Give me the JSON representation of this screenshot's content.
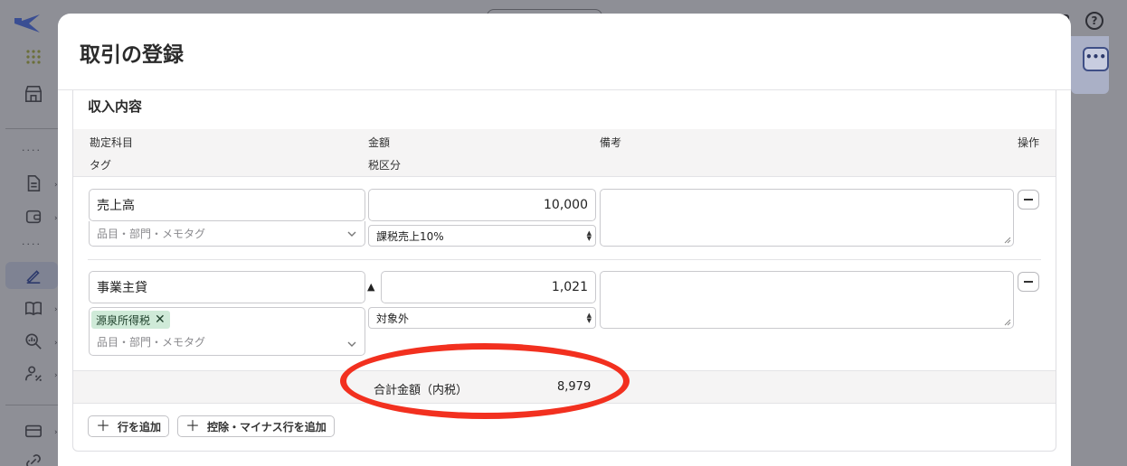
{
  "modal": {
    "title": "取引の登録",
    "section_title": "収入内容",
    "headers": {
      "account": "勘定科目",
      "amount": "金額",
      "note": "備考",
      "action": "操作",
      "tag": "タグ",
      "tax": "税区分"
    },
    "rows": [
      {
        "account": "売上高",
        "amount": "10,000",
        "tax": "課税売上10%",
        "tag_placeholder": "品目・部門・メモタグ",
        "note": ""
      },
      {
        "account": "事業主貸",
        "deduction_mark": "▲",
        "amount": "1,021",
        "tax": "対象外",
        "tag_chip": "源泉所得税",
        "tag_placeholder": "品目・部門・メモタグ",
        "note": ""
      }
    ],
    "total": {
      "label": "合計金額（内税）",
      "value": "8,979"
    },
    "buttons": {
      "add_row": "行を追加",
      "add_deduction_row": "控除・マイナス行を追加"
    }
  },
  "colors": {
    "annotation": "#f2301f",
    "tag_chip_bg": "#cfead8",
    "accent": "#3f4f86"
  }
}
